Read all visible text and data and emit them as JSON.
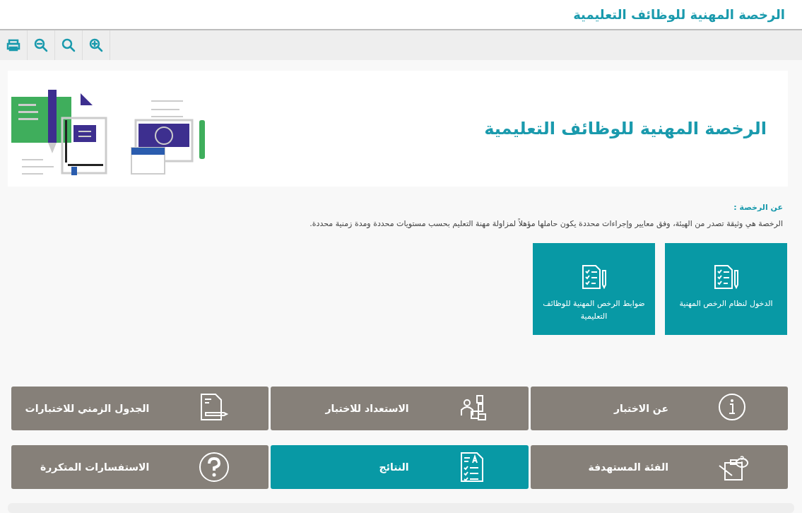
{
  "header": {
    "title": "الرخصة المهنية للوظائف التعليمية"
  },
  "toolbar": [
    {
      "kind": "print"
    },
    {
      "kind": "zoom-out"
    },
    {
      "kind": "search"
    },
    {
      "kind": "zoom-in"
    }
  ],
  "banner": {
    "title": "الرخصة المهنية للوظائف التعليمية"
  },
  "about": {
    "heading": "عن الرخصة :",
    "text": "الرخصة هي وثيقة تصدر من الهيئة، وفق معايير وإجراءات محددة يكون حاملها مؤهلاً لمزاولة مهنة التعليم بحسب مستويات محددة ومدة زمنية محددة."
  },
  "cards": [
    {
      "label": "الدخول لنظام الرخص المهنية"
    },
    {
      "label": "ضوابط الرخص المهنية للوظائف التعليمية"
    }
  ],
  "tiles": [
    {
      "label": "عن الاختبار",
      "kind": "info",
      "selected": false
    },
    {
      "label": "الاستعداد للاختبار",
      "kind": "study",
      "selected": false
    },
    {
      "label": "الجدول الزمني للاختبارات",
      "kind": "schedule",
      "selected": false
    },
    {
      "label": "الفئة المستهدفة",
      "kind": "target",
      "selected": false
    },
    {
      "label": "النتائج",
      "kind": "results",
      "selected": true
    },
    {
      "label": "الاستفسارات المتكررة",
      "kind": "faq",
      "selected": false
    }
  ]
}
